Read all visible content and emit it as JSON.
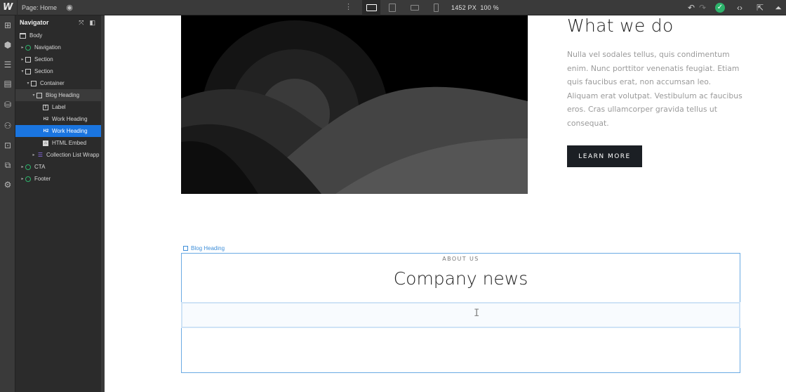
{
  "topbar": {
    "logo": "W",
    "page_label": "Page: Home",
    "size_px": "1452 PX",
    "zoom": "100 %",
    "devices": [
      "desktop-active",
      "tablet",
      "mobile-landscape",
      "mobile-portrait"
    ]
  },
  "rail": {
    "icons": [
      "add-icon",
      "components-icon",
      "navigator-icon",
      "pages-icon",
      "cms-icon",
      "users-icon",
      "ecommerce-icon",
      "assets-icon",
      "settings-icon"
    ]
  },
  "navigator": {
    "title": "Navigator",
    "items": [
      {
        "label": "Body",
        "icon": "body"
      },
      {
        "label": "Navigation",
        "icon": "symbol"
      },
      {
        "label": "Section",
        "icon": "box"
      },
      {
        "label": "Section",
        "icon": "box"
      },
      {
        "label": "Container",
        "icon": "box"
      },
      {
        "label": "Blog Heading",
        "icon": "box"
      },
      {
        "label": "Label",
        "icon": "text"
      },
      {
        "label": "Work Heading",
        "icon": "h2"
      },
      {
        "label": "Work Heading",
        "icon": "h2"
      },
      {
        "label": "HTML Embed",
        "icon": "embed"
      },
      {
        "label": "Collection List Wrapp",
        "icon": "collection"
      },
      {
        "label": "CTA",
        "icon": "symbol"
      },
      {
        "label": "Footer",
        "icon": "symbol"
      }
    ],
    "h2_badge": "H2",
    "text_badge": "T",
    "embed_badge": "</>"
  },
  "canvas": {
    "what_we_do": {
      "title": "What we do",
      "body": "Nulla vel sodales tellus, quis condimentum enim. Nunc porttitor venenatis feugiat. Etiam quis faucibus erat, non accumsan leo. Aliquam erat volutpat. Vestibulum ac faucibus eros. Cras ullamcorper gravida tellus ut consequat.",
      "button": "LEARN MORE"
    },
    "selection_label": "Blog Heading",
    "blog": {
      "eyebrow": "ABOUT US",
      "title": "Company news"
    }
  }
}
